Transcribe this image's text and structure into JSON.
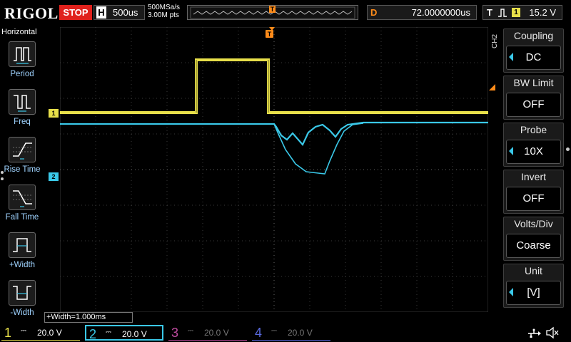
{
  "header": {
    "brand": "RIGOL",
    "run_state": "STOP",
    "timebase_label": "H",
    "timebase_value": "500us",
    "sample_rate": "500MSa/s",
    "memory_depth": "3.00M pts",
    "trigger_marker": "T",
    "delay_label": "D",
    "delay_value": "72.0000000us",
    "trigger_label": "T",
    "trigger_source": "1",
    "trigger_level": "15.2 V"
  },
  "left_menu": {
    "title": "Horizontal",
    "items": [
      {
        "label": "Period",
        "icon": "period-icon"
      },
      {
        "label": "Freq",
        "icon": "freq-icon"
      },
      {
        "label": "Rise Time",
        "icon": "rise-time-icon"
      },
      {
        "label": "Fall Time",
        "icon": "fall-time-icon"
      },
      {
        "label": "+Width",
        "icon": "positive-width-icon"
      },
      {
        "label": "-Width",
        "icon": "negative-width-icon"
      }
    ]
  },
  "right_menu": {
    "channel_tag": "CH2",
    "items": [
      {
        "title": "Coupling",
        "value": "DC",
        "has_arrow": true
      },
      {
        "title": "BW Limit",
        "value": "OFF",
        "has_arrow": false
      },
      {
        "title": "Probe",
        "value": "10X",
        "has_arrow": true
      },
      {
        "title": "Invert",
        "value": "OFF",
        "has_arrow": false
      },
      {
        "title": "Volts/Div",
        "value": "Coarse",
        "has_arrow": false
      },
      {
        "title": "Unit",
        "value": "[V]",
        "has_arrow": true
      }
    ]
  },
  "waveform": {
    "ch1_marker": "1",
    "ch2_marker": "2"
  },
  "measurement": {
    "text": "+Width=1.000ms"
  },
  "channels": [
    {
      "num": "1",
      "coupling": "⎓",
      "scale": "20.0 V",
      "color": "#e8e04a",
      "active": false
    },
    {
      "num": "2",
      "coupling": "⎓",
      "scale": "20.0 V",
      "color": "#3ac8e8",
      "active": true
    },
    {
      "num": "3",
      "coupling": "⎓",
      "scale": "20.0 V",
      "color": "#c04ca0",
      "active": false
    },
    {
      "num": "4",
      "coupling": "⎓",
      "scale": "20.0 V",
      "color": "#5a6ae0",
      "active": false
    }
  ],
  "colors": {
    "ch1": "#e8e04a",
    "ch2": "#3ac8e8",
    "trigger": "#ff8c1a",
    "stop": "#e0211c"
  }
}
